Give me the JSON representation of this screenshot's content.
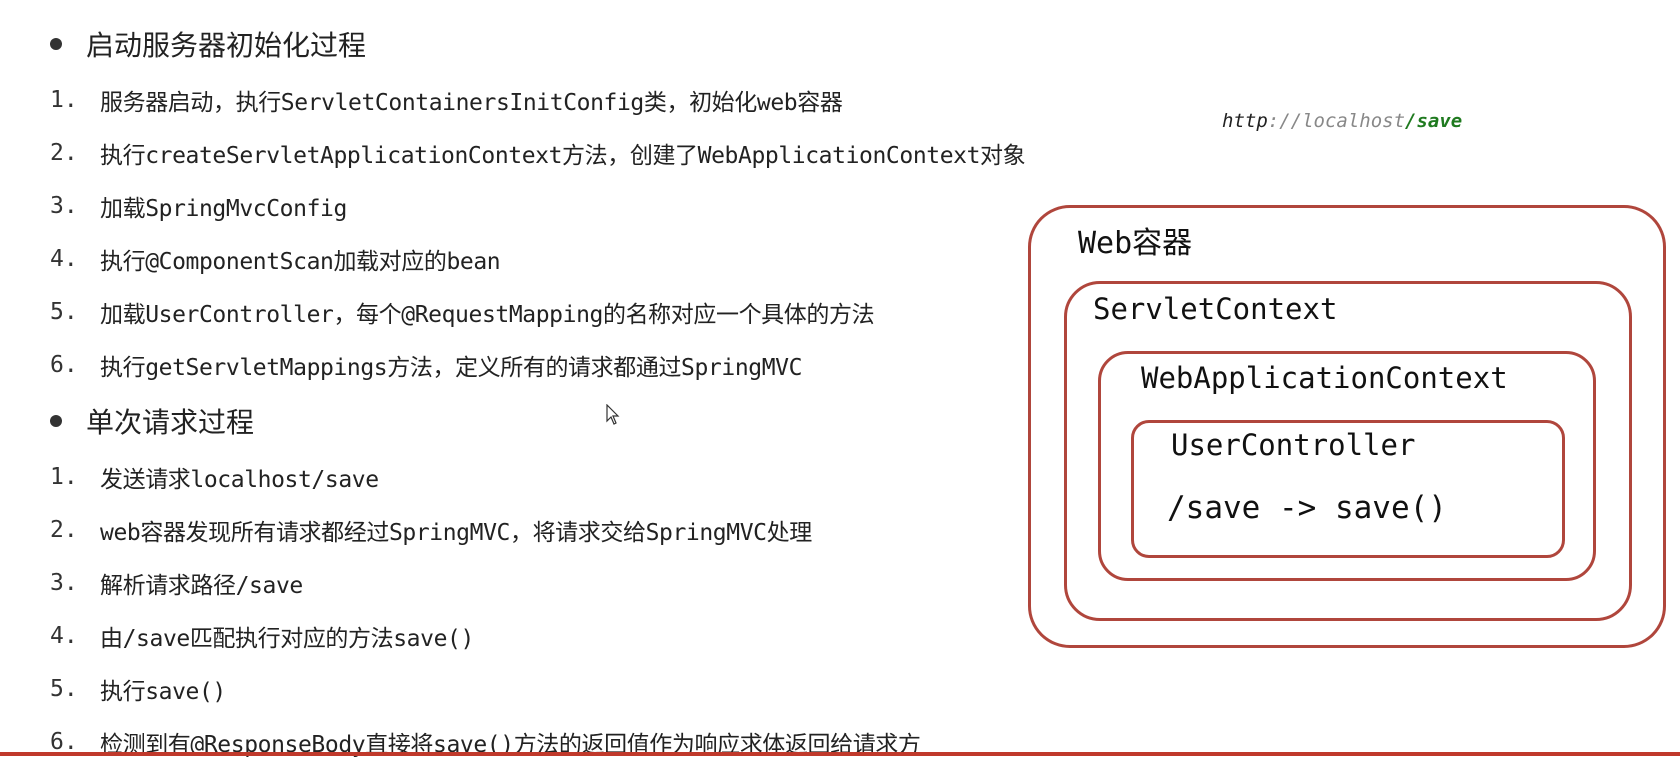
{
  "section1": {
    "title": "启动服务器初始化过程",
    "steps": [
      {
        "num": "1.",
        "text": "服务器启动，执行ServletContainersInitConfig类，初始化web容器"
      },
      {
        "num": "2.",
        "text": "执行createServletApplicationContext方法，创建了WebApplicationContext对象"
      },
      {
        "num": "3.",
        "text": "加载SpringMvcConfig"
      },
      {
        "num": "4.",
        "text": "执行@ComponentScan加载对应的bean"
      },
      {
        "num": "5.",
        "text": "加载UserController，每个@RequestMapping的名称对应一个具体的方法"
      },
      {
        "num": "6.",
        "text": "执行getServletMappings方法，定义所有的请求都通过SpringMVC"
      }
    ]
  },
  "section2": {
    "title": "单次请求过程",
    "steps": [
      {
        "num": "1.",
        "text": "发送请求localhost/save"
      },
      {
        "num": "2.",
        "text": "web容器发现所有请求都经过SpringMVC，将请求交给SpringMVC处理"
      },
      {
        "num": "3.",
        "text": "解析请求路径/save"
      },
      {
        "num": "4.",
        "text": "由/save匹配执行对应的方法save()"
      },
      {
        "num": "5.",
        "text": "执行save()"
      },
      {
        "num": "6.",
        "text": "检测到有@ResponseBody直接将save()方法的返回值作为响应求体返回给请求方"
      }
    ]
  },
  "url": {
    "scheme": "http",
    "separator": "://",
    "host": "localhost",
    "path": "/save"
  },
  "diagram": {
    "web_container": "Web容器",
    "servlet_context": "ServletContext",
    "web_application_context": "WebApplicationContext",
    "user_controller": "UserController",
    "mapping": "/save -> save()"
  },
  "colors": {
    "box_border": "#b0463c",
    "url_path": "#1f7a1f",
    "accent_line": "#c0392b"
  }
}
